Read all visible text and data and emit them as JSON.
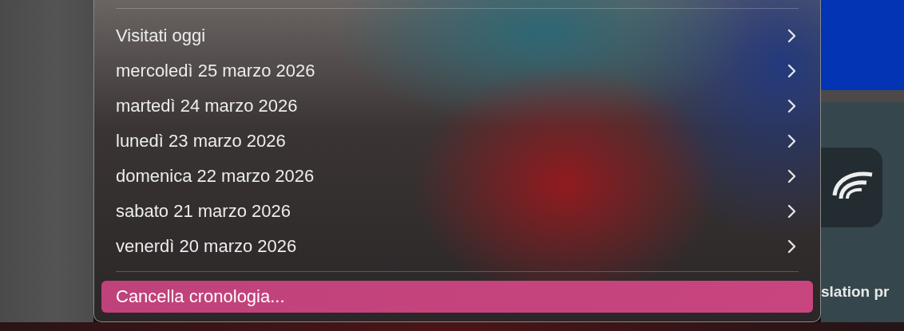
{
  "history_menu": {
    "items": [
      {
        "label": "Visitati oggi",
        "has_submenu": true
      },
      {
        "label": "mercoledì 25 marzo 2026",
        "has_submenu": true
      },
      {
        "label": "martedì 24 marzo 2026",
        "has_submenu": true
      },
      {
        "label": "lunedì 23 marzo 2026",
        "has_submenu": true
      },
      {
        "label": "domenica 22 marzo 2026",
        "has_submenu": true
      },
      {
        "label": "sabato 21 marzo 2026",
        "has_submenu": true
      },
      {
        "label": "venerdì 20 marzo 2026",
        "has_submenu": true
      }
    ],
    "clear_action": {
      "label": "Cancella cronologia...",
      "selected": true
    }
  },
  "background_window": {
    "caption": "slation pr"
  }
}
